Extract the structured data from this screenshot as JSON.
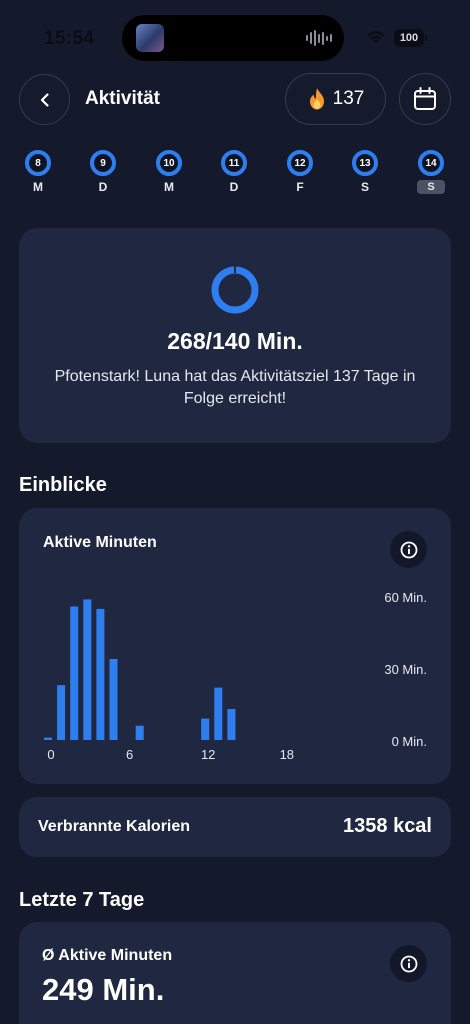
{
  "status_bar": {
    "time": "15:54",
    "battery": "100"
  },
  "header": {
    "title": "Aktivität",
    "streak": "137"
  },
  "week": [
    {
      "num": "8",
      "letter": "M",
      "progress": 1,
      "active": false
    },
    {
      "num": "9",
      "letter": "D",
      "progress": 1,
      "active": false
    },
    {
      "num": "10",
      "letter": "M",
      "progress": 1,
      "active": false
    },
    {
      "num": "11",
      "letter": "D",
      "progress": 1,
      "active": false
    },
    {
      "num": "12",
      "letter": "F",
      "progress": 1,
      "active": false
    },
    {
      "num": "13",
      "letter": "S",
      "progress": 1,
      "active": false
    },
    {
      "num": "14",
      "letter": "S",
      "progress": 1,
      "active": true
    }
  ],
  "goal": {
    "value": "268/140 Min.",
    "message": "Pfotenstark! Luna hat das Aktivitätsziel 137 Tage in Folge erreicht!"
  },
  "insights": {
    "title": "Einblicke",
    "active_minutes": {
      "title": "Aktive Minuten",
      "chart_data": {
        "type": "bar",
        "x": [
          0,
          1,
          2,
          3,
          4,
          5,
          6,
          7,
          8,
          9,
          10,
          11,
          12,
          13,
          14,
          15,
          16,
          17,
          18,
          19,
          20,
          21,
          22,
          23
        ],
        "values": [
          1,
          23,
          56,
          59,
          55,
          34,
          0,
          6,
          0,
          0,
          0,
          0,
          9,
          22,
          13,
          0,
          0,
          0,
          0,
          0,
          0,
          0,
          0,
          0
        ],
        "ylim": [
          0,
          60
        ],
        "y_ticks": [
          "60 Min.",
          "30 Min.",
          "0 Min."
        ],
        "x_ticks": [
          "0",
          "6",
          "12",
          "18"
        ],
        "color": "#2f7ef0"
      }
    },
    "calories": {
      "label": "Verbrannte Kalorien",
      "value": "1358 kcal"
    }
  },
  "last7": {
    "title": "Letzte 7 Tage",
    "avg_label": "Ø Aktive Minuten",
    "avg_value": "249 Min."
  },
  "colors": {
    "accent": "#2f7ef0",
    "card": "#1f2840",
    "background": "#141a2c",
    "flame": "#f59a2a"
  }
}
